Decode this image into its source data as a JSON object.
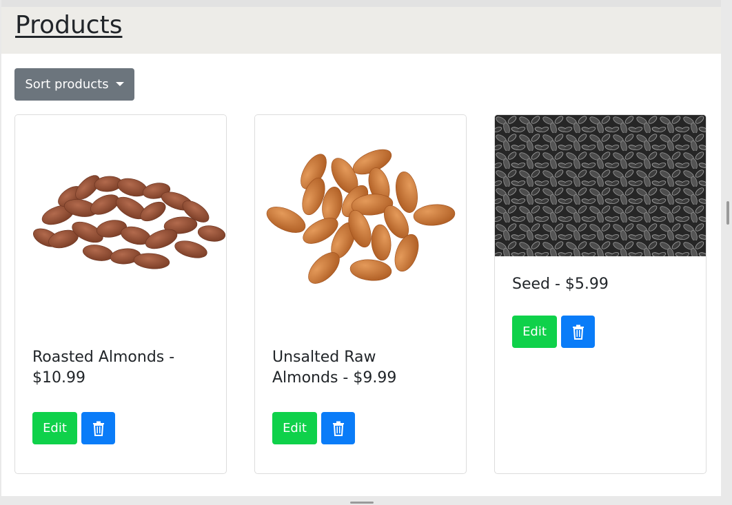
{
  "header": {
    "title": "Products"
  },
  "toolbar": {
    "sort_label": "Sort products"
  },
  "products": [
    {
      "title": "Roasted Almonds - $10.99",
      "edit_label": "Edit",
      "image_icon": "roasted-almonds-image"
    },
    {
      "title": "Unsalted Raw Almonds - $9.99",
      "edit_label": "Edit",
      "image_icon": "raw-almonds-image"
    },
    {
      "title": "Seed - $5.99",
      "edit_label": "Edit",
      "image_icon": "sunflower-seeds-image"
    }
  ],
  "icons": {
    "delete": "trash-icon",
    "sort_caret": "caret-down-icon"
  },
  "colors": {
    "edit_button": "#0fd14a",
    "delete_button": "#0a7cf8",
    "sort_button": "#6c757d",
    "header_bg": "#edece8"
  }
}
